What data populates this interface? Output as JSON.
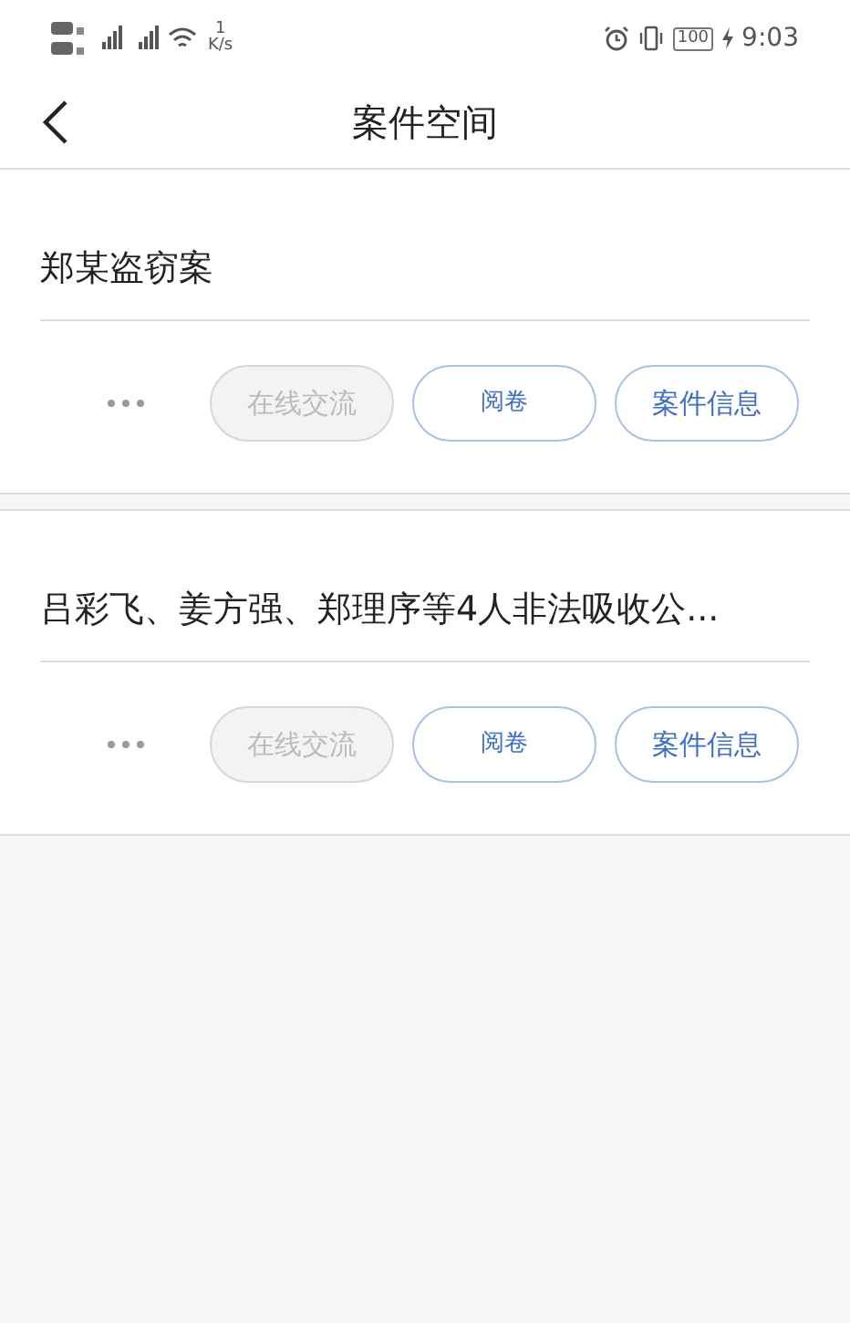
{
  "status_bar": {
    "speed_value": "1",
    "speed_unit": "K/s",
    "battery": "100",
    "time": "9:03"
  },
  "nav": {
    "title": "案件空间"
  },
  "cases": [
    {
      "title": "郑某盗窃案",
      "buttons": [
        {
          "label": "在线交流",
          "disabled": true
        },
        {
          "label": "阅卷",
          "disabled": false
        },
        {
          "label": "案件信息",
          "disabled": false
        }
      ]
    },
    {
      "title": "吕彩飞、姜方强、郑理序等4人非法吸收公...",
      "buttons": [
        {
          "label": "在线交流",
          "disabled": true
        },
        {
          "label": "阅卷",
          "disabled": false
        },
        {
          "label": "案件信息",
          "disabled": false
        }
      ]
    }
  ]
}
